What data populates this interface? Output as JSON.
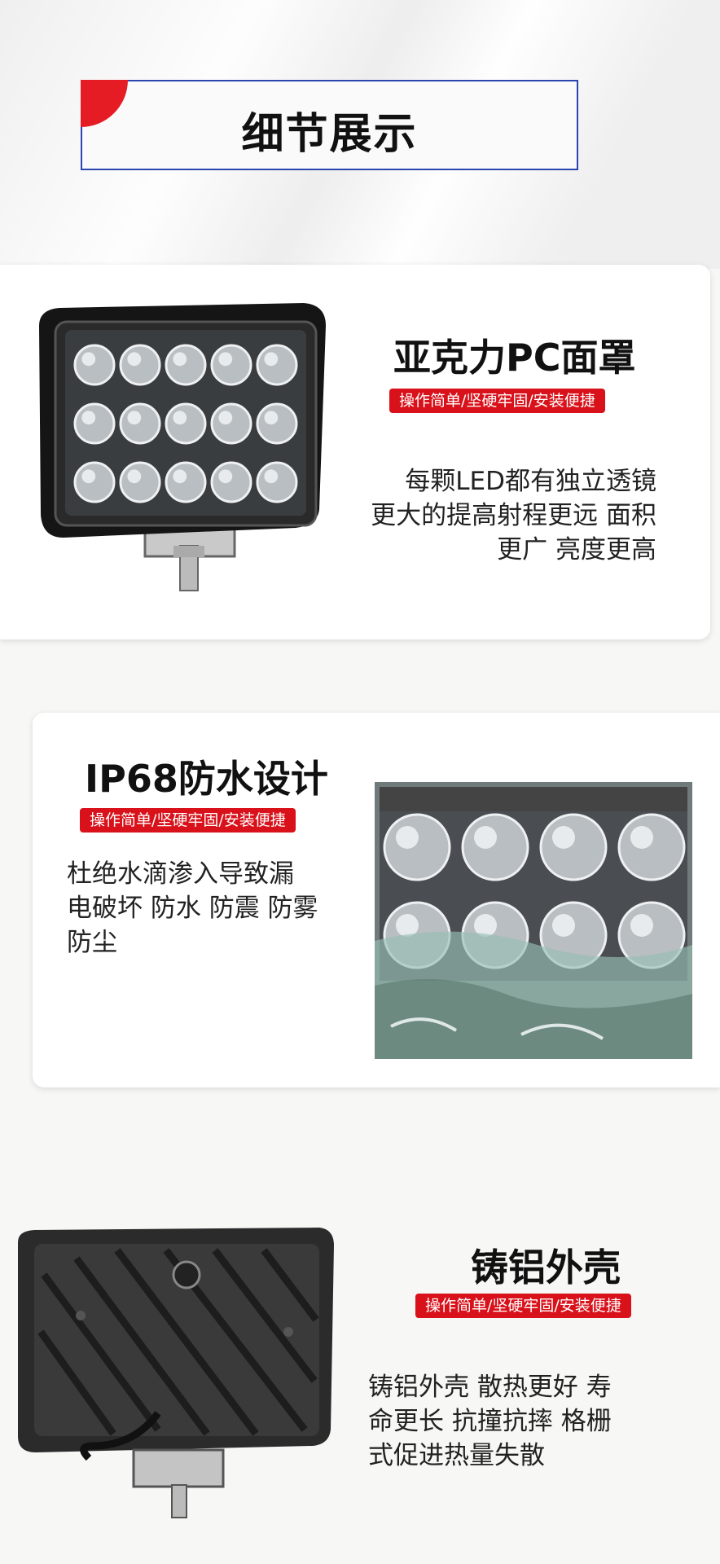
{
  "header": {
    "title": "细节展示"
  },
  "sections": [
    {
      "heading": "亚克力PC面罩",
      "tag": "操作简单/坚硬牢固/安装便捷",
      "lines": [
        "每颗LED都有独立透镜",
        "更大的提高射程更远 面积",
        "更广 亮度更高"
      ]
    },
    {
      "heading": "IP68防水设计",
      "tag": "操作简单/坚硬牢固/安装便捷",
      "lines": [
        "杜绝水滴渗入导致漏",
        "电破坏 防水 防震 防雾",
        "防尘"
      ]
    },
    {
      "heading": "铸铝外壳",
      "tag": "操作简单/坚硬牢固/安装便捷",
      "lines": [
        "铸铝外壳 散热更好 寿",
        "命更长 抗撞抗摔 格栅",
        "式促进热量失散"
      ]
    }
  ],
  "colors": {
    "accent_red": "#d8111a",
    "title_border_blue": "#2a45b0"
  }
}
